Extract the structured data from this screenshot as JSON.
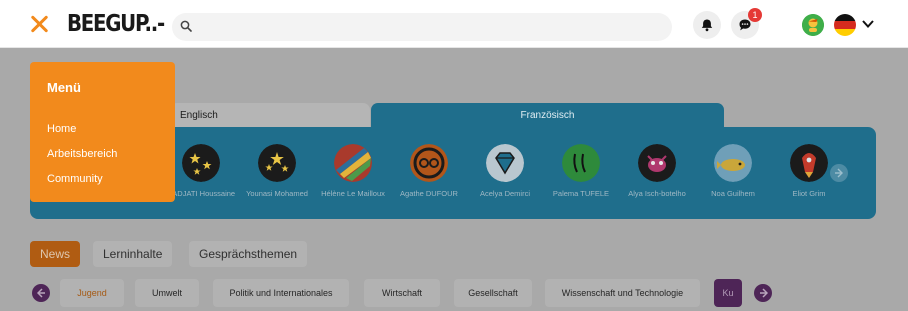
{
  "header": {
    "logo_text": "BEEGUP..-",
    "search_placeholder": "",
    "chat_badge": "1"
  },
  "menu": {
    "title": "Menü",
    "items": [
      "Home",
      "Arbeitsbereich",
      "Community"
    ]
  },
  "language_tabs": [
    "Englisch",
    "Französisch"
  ],
  "tutors": [
    {
      "name": "NADJATI Houssaine",
      "color": "#1b1b1b"
    },
    {
      "name": "Younasi Mohamed",
      "color": "#1b1b1b"
    },
    {
      "name": "Hélène Le Mailloux",
      "color": "#a93a2c"
    },
    {
      "name": "Agathe DUFOUR",
      "color": "#b2561a"
    },
    {
      "name": "Acelya Demirci",
      "color": "#b9c7cf"
    },
    {
      "name": "Palema TUFELE",
      "color": "#2e8a3b"
    },
    {
      "name": "Alya Isch-botelho",
      "color": "#1b1b1b"
    },
    {
      "name": "Noa Guilhem",
      "color": "#6f9fb8"
    },
    {
      "name": "Eliot Grim",
      "color": "#1b1b1b"
    }
  ],
  "categories": [
    "News",
    "Lerninhalte",
    "Gesprächsthemen"
  ],
  "topics": [
    "Jugend",
    "Umwelt",
    "Politik und Internationales",
    "Wirtschaft",
    "Gesellschaft",
    "Wissenschaft und Technologie",
    "Ku"
  ],
  "colors": {
    "accent_orange": "#f28a1c",
    "panel_blue": "#1f6e8c",
    "purple": "#4e2557"
  }
}
